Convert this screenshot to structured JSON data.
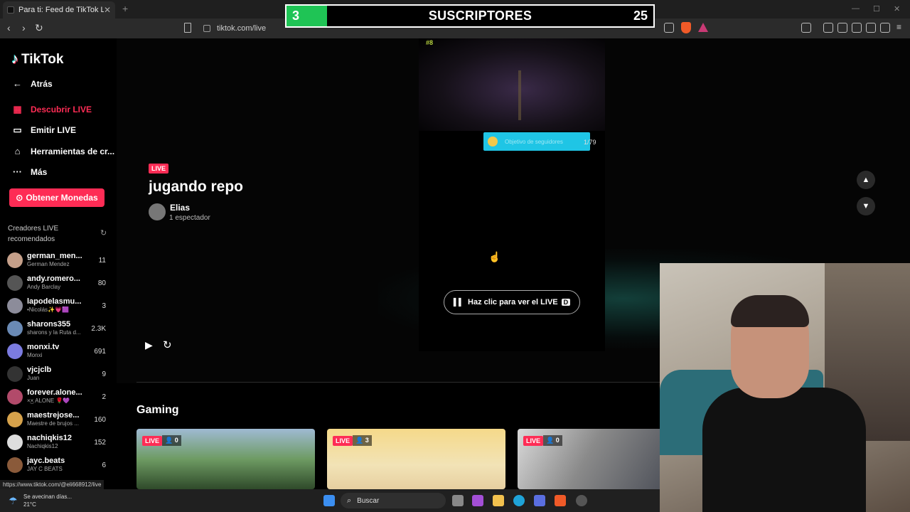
{
  "browser": {
    "tab_title": "Para ti: Feed de TikTok LIVE",
    "url": "tiktok.com/live",
    "status_link": "https://www.tiktok.com/@eli668912/live"
  },
  "overlay": {
    "current": "3",
    "label": "SUSCRIPTORES",
    "goal": "25"
  },
  "sidebar": {
    "brand": "TikTok",
    "back": "Atrás",
    "nav": [
      {
        "label": "Descubrir LIVE",
        "icon": "calendar-icon"
      },
      {
        "label": "Emitir LIVE",
        "icon": "camera-icon"
      },
      {
        "label": "Herramientas de cr...",
        "icon": "home-icon"
      },
      {
        "label": "Más",
        "icon": "more-icon"
      }
    ],
    "coins_button": "Obtener Monedas",
    "recommended_header": "Creadores LIVE recomendados",
    "creators": [
      {
        "name": "german_men...",
        "sub": "German Mendez",
        "count": "11",
        "color": "#c5a08a"
      },
      {
        "name": "andy.romero...",
        "sub": "Andy Barclay",
        "count": "80",
        "color": "#555"
      },
      {
        "name": "lapodelasmu...",
        "sub": "•Nicolás✨💗🟪",
        "count": "3",
        "color": "#8c8c9a"
      },
      {
        "name": "sharons355",
        "sub": "sharons y la Ruta d...",
        "count": "2.3K",
        "color": "#6a8ab5"
      },
      {
        "name": "monxi.tv",
        "sub": "Monxi",
        "count": "691",
        "color": "#7b7be0"
      },
      {
        "name": "vjcjclb",
        "sub": "Juan",
        "count": "9",
        "color": "#333"
      },
      {
        "name": "forever.alone...",
        "sub": "×͜× ALONE 🌹💜",
        "count": "2",
        "color": "#b24a6a"
      },
      {
        "name": "maestrejose...",
        "sub": "Maestre de brujos ...",
        "count": "160",
        "color": "#d6a24b"
      },
      {
        "name": "nachiqkis12",
        "sub": "Nachiqkis12",
        "count": "152",
        "color": "#ddd"
      },
      {
        "name": "jayc.beats",
        "sub": "JAY C BEATS",
        "count": "6",
        "color": "#8a5a3a"
      }
    ]
  },
  "stream": {
    "live_label": "LIVE",
    "title": "jugando repo",
    "host": "Elias",
    "viewers": "1 espectador",
    "watch_button": "Haz clic para ver el LIVE",
    "watch_key": "D",
    "goal_text": "Objetivo de seguidores",
    "goal_fraction": "1/79",
    "hud": "#8"
  },
  "gaming": {
    "title": "Gaming",
    "cards": [
      {
        "live": "LIVE",
        "viewers": "0",
        "bg": "linear-gradient(180deg,#9fbad3 0%,#6e9b63 50%,#2f4a2a 100%)"
      },
      {
        "live": "LIVE",
        "viewers": "3",
        "bg": "linear-gradient(180deg,#f5d98a 0%,#f2e3b6 60%,#e6cfa0 100%)"
      },
      {
        "live": "LIVE",
        "viewers": "0",
        "bg": "linear-gradient(120deg,#d9d9d9 0%,#8a8a8a 40%,#3b3f4a 100%)"
      }
    ]
  },
  "taskbar": {
    "weather_line1": "Se avecinan días...",
    "weather_line2": "21°C",
    "search_placeholder": "Buscar"
  }
}
